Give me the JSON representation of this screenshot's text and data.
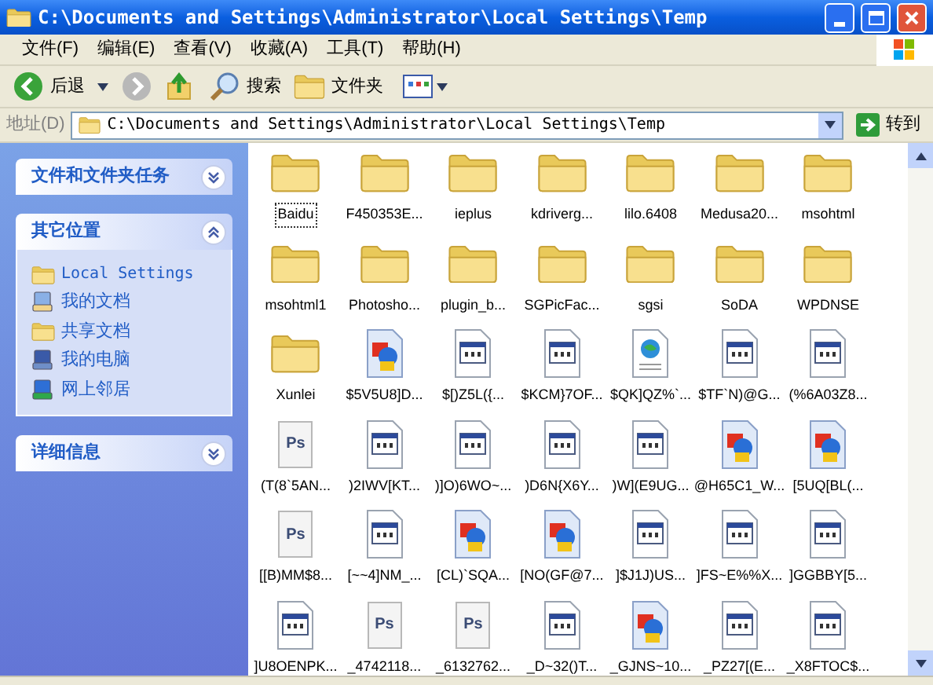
{
  "window": {
    "title": "C:\\Documents and Settings\\Administrator\\Local Settings\\Temp"
  },
  "menu": [
    "文件(F)",
    "编辑(E)",
    "查看(V)",
    "收藏(A)",
    "工具(T)",
    "帮助(H)"
  ],
  "toolbar": {
    "back": {
      "label": "后退",
      "disabled": false
    },
    "forward": {
      "disabled": true
    },
    "search": "搜索",
    "folders": "文件夹"
  },
  "address": {
    "label": "地址(D)",
    "value": "C:\\Documents and Settings\\Administrator\\Local Settings\\Temp",
    "go": "转到"
  },
  "sidebar": [
    {
      "title": "文件和文件夹任务",
      "expanded": false
    },
    {
      "title": "其它位置",
      "expanded": true,
      "items": [
        {
          "kind": "folder",
          "label": "Local Settings"
        },
        {
          "kind": "documents",
          "label": "我的文档"
        },
        {
          "kind": "folder",
          "label": "共享文档"
        },
        {
          "kind": "computer",
          "label": "我的电脑"
        },
        {
          "kind": "network",
          "label": "网上邻居"
        }
      ]
    },
    {
      "title": "详细信息",
      "expanded": false
    }
  ],
  "files": [
    {
      "kind": "folder",
      "name": "Baidu",
      "selected": true
    },
    {
      "kind": "folder",
      "name": "F450353E...",
      "selected": false
    },
    {
      "kind": "folder",
      "name": "ieplus",
      "selected": false
    },
    {
      "kind": "folder",
      "name": "kdriverg...",
      "selected": false
    },
    {
      "kind": "folder",
      "name": "lilo.6408",
      "selected": false
    },
    {
      "kind": "folder",
      "name": "Medusa20...",
      "selected": false
    },
    {
      "kind": "folder",
      "name": "msohtml",
      "selected": false
    },
    {
      "kind": "folder",
      "name": "msohtml1",
      "selected": false
    },
    {
      "kind": "folder",
      "name": "Photosho...",
      "selected": false
    },
    {
      "kind": "folder",
      "name": "plugin_b...",
      "selected": false
    },
    {
      "kind": "folder",
      "name": "SGPicFac...",
      "selected": false
    },
    {
      "kind": "folder",
      "name": "sgsi",
      "selected": false
    },
    {
      "kind": "folder",
      "name": "SoDA",
      "selected": false
    },
    {
      "kind": "folder",
      "name": "WPDNSE",
      "selected": false
    },
    {
      "kind": "folder",
      "name": "Xunlei",
      "selected": false
    },
    {
      "kind": "image",
      "name": "$5V5U8]D...",
      "selected": false
    },
    {
      "kind": "program",
      "name": "$[)Z5L({...",
      "selected": false
    },
    {
      "kind": "program",
      "name": "$KCM}7OF...",
      "selected": false
    },
    {
      "kind": "web",
      "name": "$QK]QZ%`...",
      "selected": false
    },
    {
      "kind": "program",
      "name": "$TF`N)@G...",
      "selected": false
    },
    {
      "kind": "program",
      "name": "(%6A03Z8...",
      "selected": false
    },
    {
      "kind": "ps",
      "icon_text": "Ps",
      "name": "(T(8`5AN...",
      "selected": false
    },
    {
      "kind": "program",
      "name": ")2IWV[KT...",
      "selected": false
    },
    {
      "kind": "program",
      "name": ")]O)6WO~...",
      "selected": false
    },
    {
      "kind": "program",
      "name": ")D6N{X6Y...",
      "selected": false
    },
    {
      "kind": "program",
      "name": ")W](E9UG...",
      "selected": false
    },
    {
      "kind": "image",
      "name": "@H65C1_W...",
      "selected": false
    },
    {
      "kind": "image",
      "name": "[5UQ[BL(...",
      "selected": false
    },
    {
      "kind": "ps",
      "icon_text": "Ps",
      "name": "[[B)MM$8...",
      "selected": false
    },
    {
      "kind": "program",
      "name": "[~~4]NM_...",
      "selected": false
    },
    {
      "kind": "image",
      "name": "[CL)`SQA...",
      "selected": false
    },
    {
      "kind": "image",
      "name": "[NO(GF@7...",
      "selected": false
    },
    {
      "kind": "program",
      "name": "]$J1J)US...",
      "selected": false
    },
    {
      "kind": "program",
      "name": "]FS~E%%X...",
      "selected": false
    },
    {
      "kind": "program",
      "name": "]GGBBY[5...",
      "selected": false
    },
    {
      "kind": "program",
      "name": "]U8OENPK...",
      "selected": false
    },
    {
      "kind": "ps",
      "icon_text": "Ps",
      "name": "_4742118...",
      "selected": false
    },
    {
      "kind": "ps",
      "icon_text": "Ps",
      "name": "_6132762...",
      "selected": false
    },
    {
      "kind": "program",
      "name": "_D~32()T...",
      "selected": false
    },
    {
      "kind": "image",
      "name": "_GJNS~10...",
      "selected": false
    },
    {
      "kind": "program",
      "name": "_PZ27[(E...",
      "selected": false
    },
    {
      "kind": "program",
      "name": "_X8FTOC$...",
      "selected": false
    }
  ]
}
